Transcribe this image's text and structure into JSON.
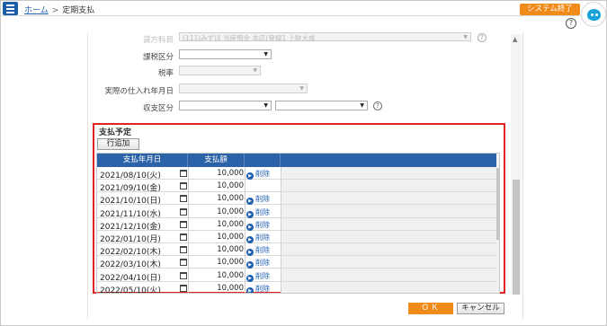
{
  "header": {
    "breadcrumb_home": "ホーム",
    "breadcrumb_sep": ">",
    "breadcrumb_current": "定期支払",
    "exit_label": "システム終了",
    "help_label": "?"
  },
  "form": {
    "debit_label": "貸方科目",
    "debit_value": "(111)みずほ 当座預金 本店(登録1  上財大成",
    "tax_category_label": "課税区分",
    "tax_rate_label": "税率",
    "purchase_date_label": "実際の仕入れ年月日",
    "income_expense_label": "収支区分",
    "help_label": "?"
  },
  "schedule": {
    "title": "支払予定",
    "add_row_label": "行追加",
    "columns": [
      "支払年月日",
      "支払額"
    ],
    "delete_label": "削除",
    "rows": [
      {
        "date": "2021/08/10(火)",
        "amount": "10,000",
        "deletable": true
      },
      {
        "date": "2021/09/10(金)",
        "amount": "10,000",
        "deletable": false
      },
      {
        "date": "2021/10/10(日)",
        "amount": "10,000",
        "deletable": true
      },
      {
        "date": "2021/11/10(水)",
        "amount": "10,000",
        "deletable": true
      },
      {
        "date": "2021/12/10(金)",
        "amount": "10,000",
        "deletable": true
      },
      {
        "date": "2022/01/10(月)",
        "amount": "10,000",
        "deletable": true
      },
      {
        "date": "2022/02/10(木)",
        "amount": "10,000",
        "deletable": true
      },
      {
        "date": "2022/03/10(木)",
        "amount": "10,000",
        "deletable": true
      },
      {
        "date": "2022/04/10(日)",
        "amount": "10,000",
        "deletable": true
      },
      {
        "date": "2022/05/10(火)",
        "amount": "10,000",
        "deletable": true
      }
    ]
  },
  "footer": {
    "ok_label": "ＯＫ",
    "cancel_label": "キャンセル"
  },
  "colors": {
    "accent_orange": "#f08a18",
    "header_blue": "#2b62a8",
    "highlight_red": "#e02424",
    "link_blue": "#1e5fb0"
  }
}
